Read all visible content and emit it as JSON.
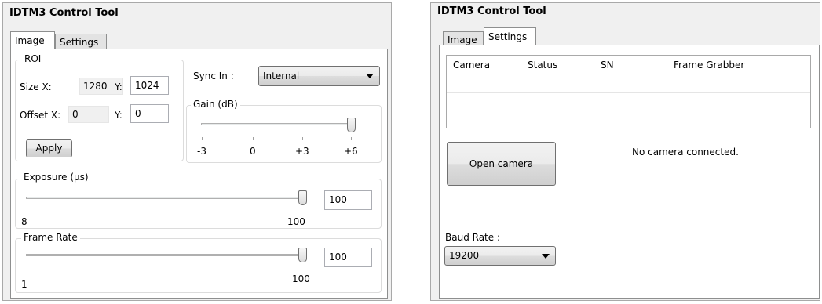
{
  "left": {
    "title": "IDTM3 Control Tool",
    "tabs": [
      "Image",
      "Settings"
    ],
    "roi": {
      "group_label": "ROI",
      "size_x_label": "Size X:",
      "size_x_value": "1280",
      "size_y_label": "Y:",
      "size_y_value": "1024",
      "offset_x_label": "Offset X:",
      "offset_x_value": "0",
      "offset_y_label": "Y:",
      "offset_y_value": "0",
      "apply_label": "Apply"
    },
    "sync": {
      "label": "Sync In :",
      "value": "Internal"
    },
    "gain": {
      "label": "Gain (dB)",
      "ticks": [
        "-3",
        "0",
        "+3",
        "+6"
      ],
      "level": 1.0
    },
    "exposure": {
      "label": "Exposure (µs)",
      "min": "8",
      "max": "100",
      "value": "100",
      "level": 1.0
    },
    "frame_rate": {
      "label": "Frame Rate",
      "min": "1",
      "max": "100",
      "value": "100",
      "level": 1.0
    }
  },
  "right": {
    "title": "IDTM3 Control Tool",
    "tabs": [
      "Image",
      "Settings"
    ],
    "table": {
      "columns": [
        "Camera",
        "Status",
        "SN",
        "Frame Grabber"
      ]
    },
    "open_camera_label": "Open camera",
    "status_text": "No camera connected.",
    "baud": {
      "label": "Baud Rate :",
      "value": "19200"
    }
  }
}
